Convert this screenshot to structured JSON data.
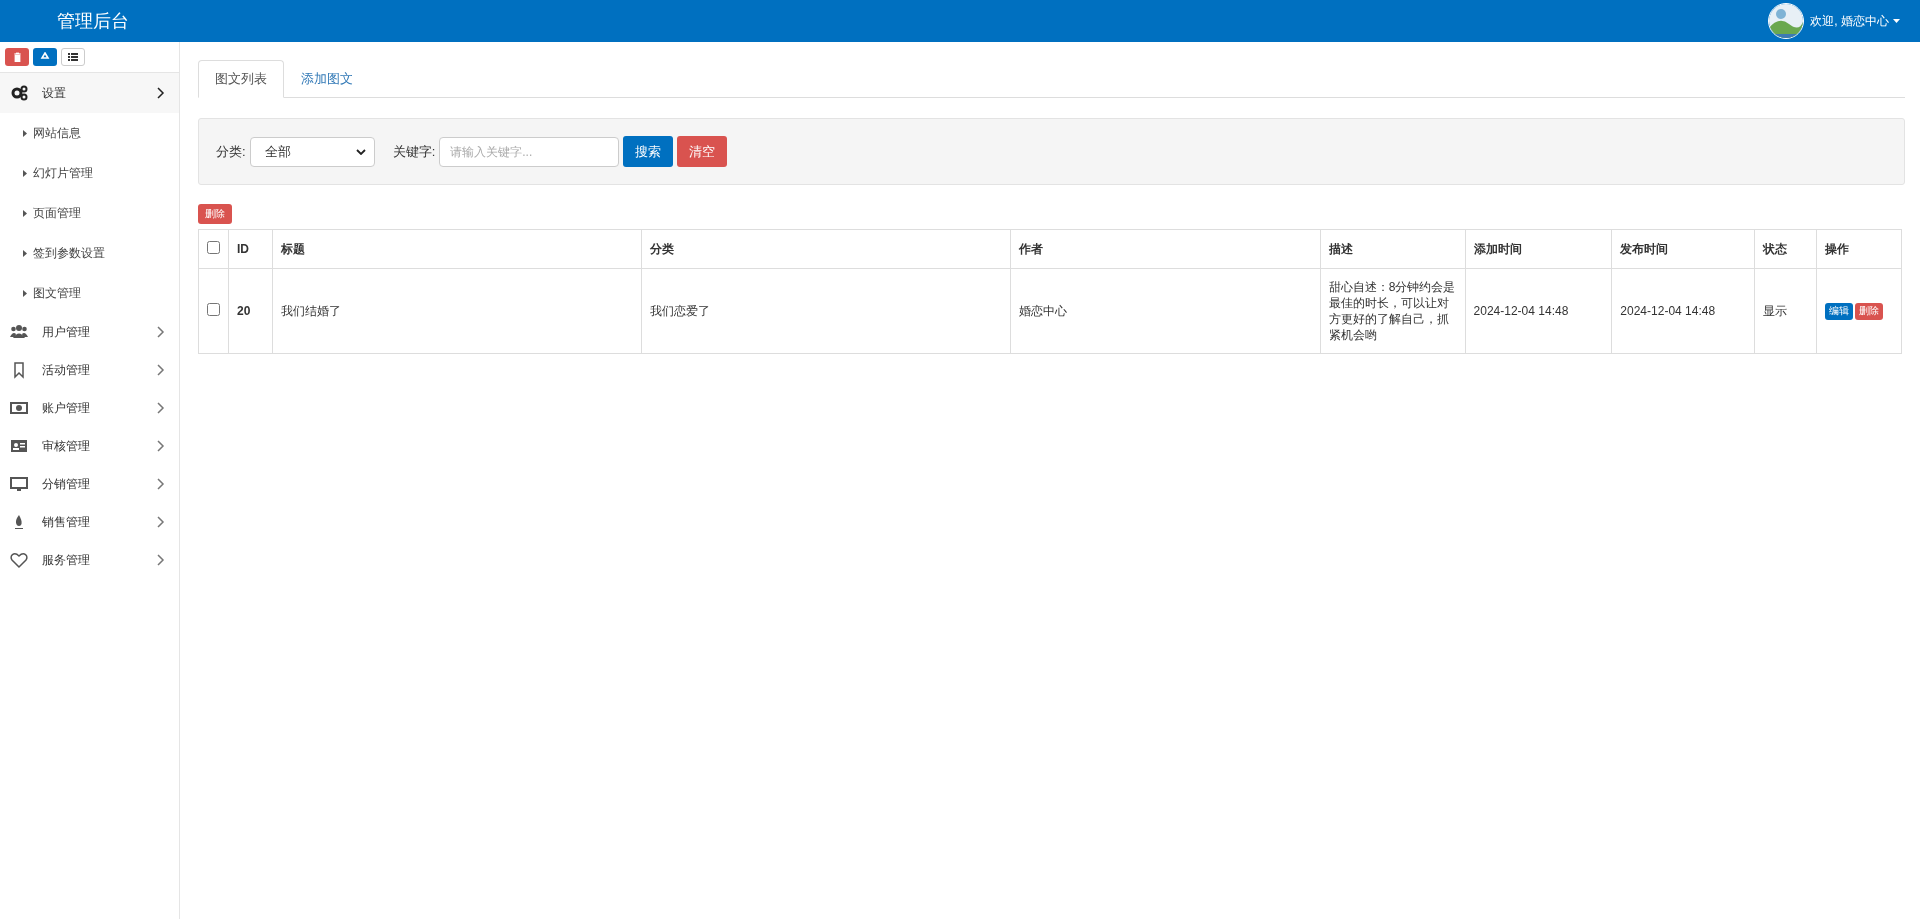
{
  "header": {
    "title": "管理后台",
    "user": "欢迎, 婚恋中心"
  },
  "sidebar": {
    "items": [
      {
        "label": "设置",
        "expanded": true,
        "children": [
          {
            "label": "网站信息"
          },
          {
            "label": "幻灯片管理"
          },
          {
            "label": "页面管理"
          },
          {
            "label": "签到参数设置"
          },
          {
            "label": "图文管理"
          }
        ]
      },
      {
        "label": "用户管理",
        "expanded": false
      },
      {
        "label": "活动管理",
        "expanded": false
      },
      {
        "label": "账户管理",
        "expanded": false
      },
      {
        "label": "审核管理",
        "expanded": false
      },
      {
        "label": "分销管理",
        "expanded": false
      },
      {
        "label": "销售管理",
        "expanded": false
      },
      {
        "label": "服务管理",
        "expanded": false
      }
    ]
  },
  "tabs": [
    {
      "label": "图文列表",
      "selected": true
    },
    {
      "label": "添加图文",
      "selected": false
    }
  ],
  "filter": {
    "category_label": "分类:",
    "category_value": "全部",
    "keyword_label": "关键字:",
    "keyword_placeholder": "请输入关键字...",
    "search_button": "搜索",
    "clear_button": "清空"
  },
  "bulk_delete_button": "删除",
  "table": {
    "select_all": {
      "checked": false
    },
    "columns": [
      "ID",
      "标题",
      "分类",
      "作者",
      "描述",
      "添加时间",
      "发布时间",
      "状态",
      "操作"
    ],
    "rows": [
      {
        "checked": false,
        "id": "20",
        "title": "我们结婚了",
        "category": "我们恋爱了",
        "author": "婚恋中心",
        "description": "甜心自述：8分钟约会是最佳的时长，可以让对方更好的了解自己，抓紧机会哟",
        "added": "2024-12-04 14:48",
        "published": "2024-12-04 14:48",
        "status": "显示",
        "actions": [
          "编辑",
          "删除"
        ]
      }
    ]
  }
}
